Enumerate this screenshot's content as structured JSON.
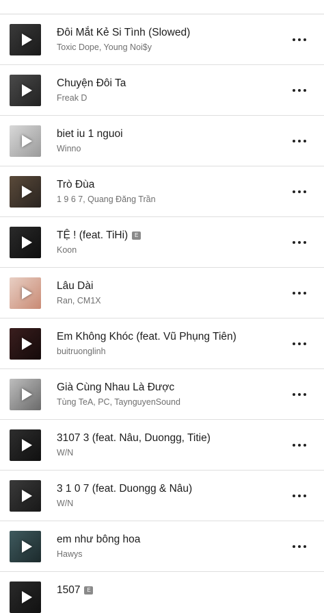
{
  "songs": [
    {
      "title": "Đôi Mắt Kẻ Si Tình (Slowed)",
      "artist": "Toxic Dope, Young Noi$y",
      "explicit": false,
      "art": [
        "#3a3a3a",
        "#1a1a1a"
      ]
    },
    {
      "title": "Chuyện Đôi Ta",
      "artist": "Freak D",
      "explicit": false,
      "art": [
        "#4a4a4a",
        "#222222"
      ]
    },
    {
      "title": "biet iu 1 nguoi",
      "artist": "Winno",
      "explicit": false,
      "art": [
        "#d8d8d8",
        "#9a9a9a"
      ]
    },
    {
      "title": "Trò Đùa",
      "artist": "1 9 6 7, Quang Đăng Trần",
      "explicit": false,
      "art": [
        "#5a4a3a",
        "#2a2420"
      ]
    },
    {
      "title": "TỆ ! (feat. TiHi)",
      "artist": "Koon",
      "explicit": true,
      "explicit_label": "E",
      "art": [
        "#2a2a2a",
        "#0e0e0e"
      ]
    },
    {
      "title": "Lâu Dài",
      "artist": "Ran, CM1X",
      "explicit": false,
      "art": [
        "#e8cfc4",
        "#c98a74"
      ]
    },
    {
      "title": "Em Không Khóc (feat. Vũ Phụng Tiên)",
      "artist": "buitruonglinh",
      "explicit": false,
      "art": [
        "#3a1e1e",
        "#140a0a"
      ]
    },
    {
      "title": "Già Cùng Nhau Là Được",
      "artist": "Tùng TeA, PC, TaynguyenSound",
      "explicit": false,
      "art": [
        "#bdbdbd",
        "#6a6a6a"
      ]
    },
    {
      "title": "3107 3 (feat. Nâu, Duongg, Titie)",
      "artist": "W/N",
      "explicit": false,
      "art": [
        "#2e2e2e",
        "#101010"
      ]
    },
    {
      "title": "3 1 0 7 (feat. Duongg & Nâu)",
      "artist": "W/N",
      "explicit": false,
      "art": [
        "#3a3a3a",
        "#181818"
      ]
    },
    {
      "title": "em như bông hoa",
      "artist": "Hawys",
      "explicit": false,
      "art": [
        "#3f5a5e",
        "#1c2a2c"
      ]
    },
    {
      "title": "1507",
      "artist": "",
      "explicit": true,
      "explicit_label": "E",
      "art": [
        "#2a2a2a",
        "#111111"
      ]
    }
  ]
}
